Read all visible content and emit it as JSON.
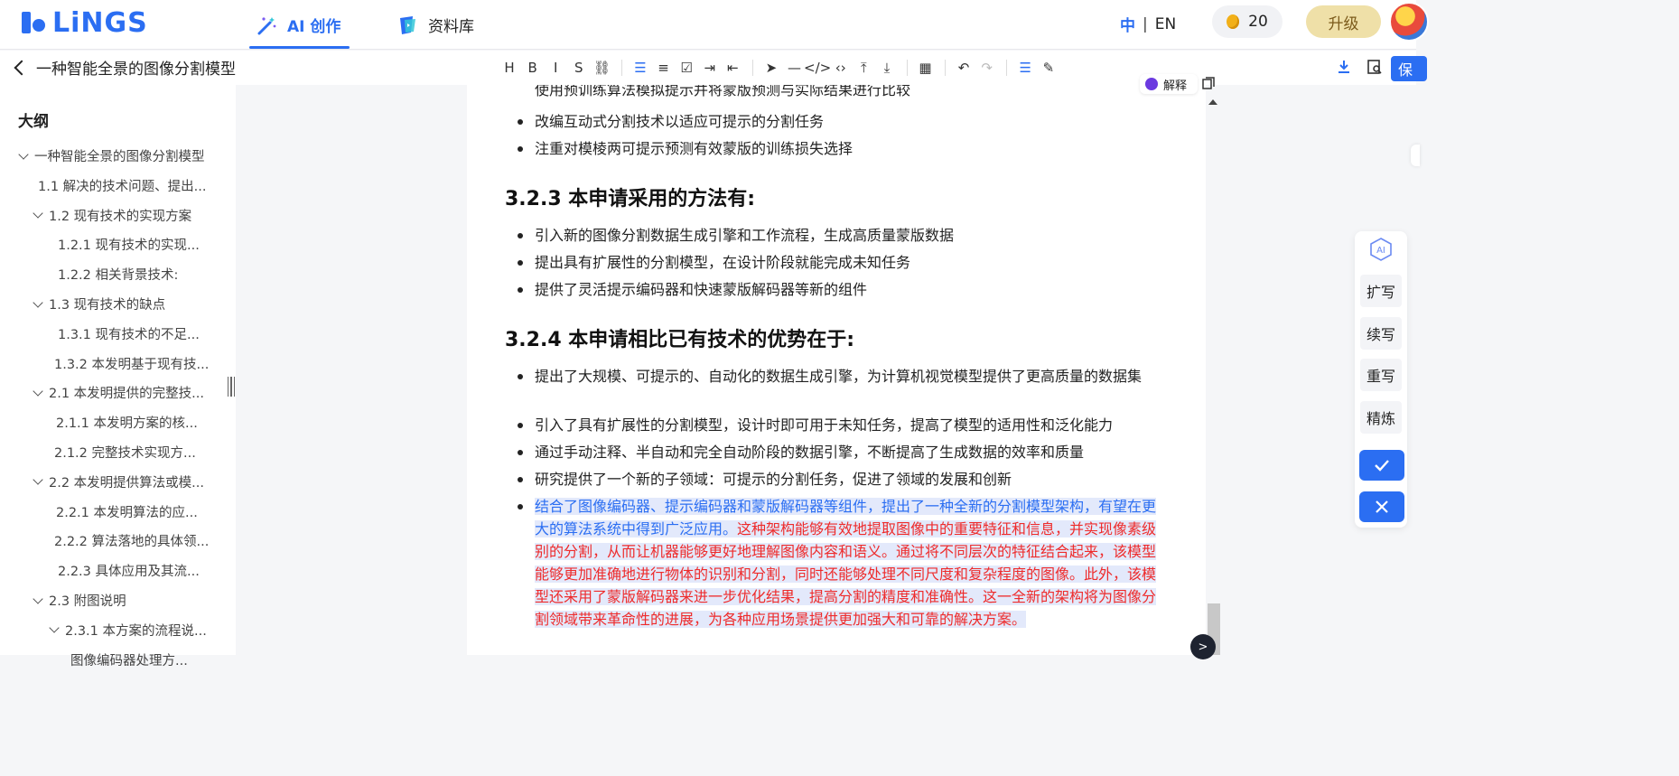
{
  "header": {
    "logo_text": "LiNGS",
    "tabs": [
      {
        "label": "AI 创作",
        "active": true,
        "icon": "magic-wand-icon"
      },
      {
        "label": "资料库",
        "active": false,
        "icon": "library-icon"
      }
    ],
    "lang_zh": "中",
    "lang_sep": "|",
    "lang_en": "EN",
    "coins": "20",
    "upgrade_label": "升级",
    "accent": "#2b6ef2"
  },
  "docbar": {
    "title": "一种智能全景的图像分割模型",
    "save_label": "保",
    "toolbar": [
      {
        "glyph": "H",
        "name": "heading-icon"
      },
      {
        "glyph": "B",
        "name": "bold-icon"
      },
      {
        "glyph": "I",
        "name": "italic-icon"
      },
      {
        "glyph": "S",
        "name": "strikethrough-icon"
      },
      {
        "glyph": "⛓",
        "name": "link-icon"
      },
      {
        "glyph": "☰",
        "name": "bullet-list-icon"
      },
      {
        "glyph": "≡",
        "name": "ordered-list-icon"
      },
      {
        "glyph": "☑",
        "name": "task-list-icon"
      },
      {
        "glyph": "⇥",
        "name": "indent-icon"
      },
      {
        "glyph": "⇤",
        "name": "outdent-icon"
      },
      {
        "glyph": "➤",
        "name": "blockquote-icon"
      },
      {
        "glyph": "—",
        "name": "horizontal-rule-icon"
      },
      {
        "glyph": "</>",
        "name": "code-block-icon"
      },
      {
        "glyph": "‹›",
        "name": "inline-code-icon"
      },
      {
        "glyph": "⤒",
        "name": "superscript-icon"
      },
      {
        "glyph": "⤓",
        "name": "subscript-icon"
      },
      {
        "glyph": "▦",
        "name": "table-icon"
      },
      {
        "glyph": "↶",
        "name": "undo-icon"
      },
      {
        "glyph": "↷",
        "name": "redo-icon"
      },
      {
        "glyph": "☰",
        "name": "align-center-icon"
      },
      {
        "glyph": "✎",
        "name": "edit-icon"
      }
    ]
  },
  "outline": {
    "title": "大纲",
    "items": [
      {
        "label": "一种智能全景的图像分割模型",
        "expanded": true
      },
      {
        "label": "1.1 解决的技术问题、提出..."
      },
      {
        "label": "1.2 现有技术的实现方案",
        "expanded": true
      },
      {
        "label": "1.2.1 现有技术的实现..."
      },
      {
        "label": "1.2.2 相关背景技术:"
      },
      {
        "label": "1.3 现有技术的缺点",
        "expanded": true
      },
      {
        "label": "1.3.1 现有技术的不足..."
      },
      {
        "label": "1.3.2 本发明基于现有技..."
      },
      {
        "label": "2.1 本发明提供的完整技...",
        "expanded": true
      },
      {
        "label": "2.1.1 本发明方案的核..."
      },
      {
        "label": "2.1.2 完整技术实现方..."
      },
      {
        "label": "2.2 本发明提供算法或模...",
        "expanded": true
      },
      {
        "label": "2.2.1 本发明算法的应..."
      },
      {
        "label": "2.2.2 算法落地的具体领..."
      },
      {
        "label": "2.2.3 具体应用及其流..."
      },
      {
        "label": "2.3 附图说明",
        "expanded": true
      },
      {
        "label": "2.3.1 本方案的流程说...",
        "expanded": true
      },
      {
        "label": "图像编码器处理方..."
      }
    ]
  },
  "document": {
    "cut_line": "使用预训练算法模拟提示并将蒙版预测与实际结果进行比较",
    "list1": [
      "改编互动式分割技术以适应可提示的分割任务",
      "注重对模棱两可提示预测有效蒙版的训练损失选择"
    ],
    "h_323": "3.2.3 本申请采用的方法有:",
    "list2": [
      "引入新的图像分割数据生成引擎和工作流程，生成高质量蒙版数据",
      "提出具有扩展性的分割模型，在设计阶段就能完成未知任务",
      "提供了灵活提示编码器和快速蒙版解码器等新的组件"
    ],
    "h_324": "3.2.4 本申请相比已有技术的优势在于:",
    "list3": [
      "提出了大规模、可提示的、自动化的数据生成引擎，为计算机视觉模型提供了更高质量的数据集",
      "引入了具有扩展性的分割模型，设计时即可用于未知任务，提高了模型的适用性和泛化能力",
      "通过手动注释、半自动和完全自动阶段的数据引擎，不断提高了生成数据的效率和质量",
      "研究提供了一个新的子领域：可提示的分割任务，促进了领域的发展和创新"
    ],
    "hl_original": "结合了图像编码器、提示编码器和蒙版解码器等组件，提出了一种全新的分割模型架构，有望在更大的算法系统中得到广泛应用。",
    "hl_generated": "这种架构能够有效地提取图像中的重要特征和信息，并实现像素级别的分割，从而让机器能够更好地理解图像内容和语义。通过将不同层次的特征结合起来，该模型能够更加准确地进行物体的识别和分割，同时还能够处理不同尺度和复杂程度的图像。此外，该模型还采用了蒙版解码器来进一步优化结果，提高分割的精度和准确性。这一全新的架构将为图像分割领域带来革命性的进展，为各种应用场景提供更加强大和可靠的解决方案。"
  },
  "floating": {
    "explain_label": "解释",
    "fab_label": ">"
  },
  "ai_panel": {
    "logo_label": "AI",
    "buttons": [
      "扩写",
      "续写",
      "重写",
      "精炼"
    ]
  }
}
